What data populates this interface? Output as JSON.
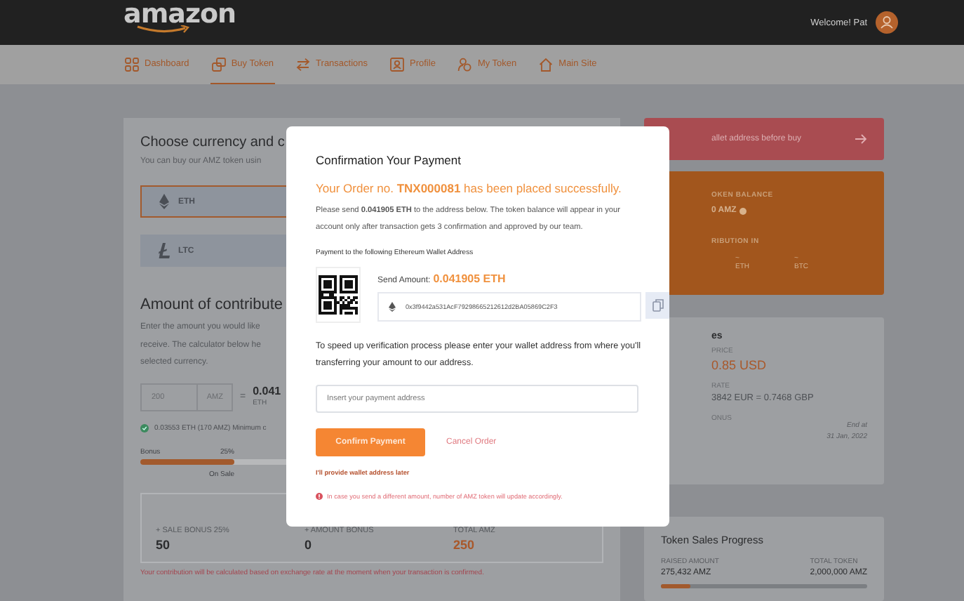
{
  "header": {
    "logo": "amazon",
    "welcome": "Welcome! Pat"
  },
  "nav": [
    {
      "label": "Dashboard",
      "selected": false
    },
    {
      "label": "Buy Token",
      "selected": true
    },
    {
      "label": "Transactions",
      "selected": false
    },
    {
      "label": "Profile",
      "selected": false
    },
    {
      "label": "My Token",
      "selected": false
    },
    {
      "label": "Main Site",
      "selected": false
    }
  ],
  "currency": {
    "title": "Choose currency and c",
    "subtitle": "You can buy our AMZ token usin",
    "options": [
      {
        "label": "ETH",
        "selected": true
      },
      {
        "label": "LTC",
        "selected": false
      }
    ]
  },
  "contribute": {
    "title": "Amount of contribute",
    "lines": [
      "Enter the amount you would like",
      "receive. The calculator below he",
      "selected currency."
    ],
    "amount": "200",
    "unit": "AMZ",
    "equals": "=",
    "result": "0.041",
    "result_unit": "ETH",
    "minimum": "0.03553 ETH (170 AMZ) Minimum c",
    "bonus_label": "Bonus",
    "bonus_value": "25%",
    "bonus_bar": {
      "level": 0.35
    },
    "bonus_caption": "On Sale",
    "totals": [
      {
        "label": "+ SALE BONUS 25%",
        "value": "50"
      },
      {
        "label": "+ AMOUNT BONUS",
        "value": "0"
      },
      {
        "label": "TOTAL AMZ",
        "value": "250"
      }
    ],
    "note": "Your contribution will be calculated based on exchange rate at the moment when your transaction is confirmed."
  },
  "banner": {
    "text": "allet address before buy"
  },
  "balance": {
    "label": "OKEN BALANCE",
    "value": "0 AMZ",
    "dist_label": "RIBUTION IN",
    "items": [
      {
        "value": "~",
        "unit": "ETH"
      },
      {
        "value": "~",
        "unit": "BTC"
      }
    ]
  },
  "sales": {
    "title": "es",
    "price_label": "PRICE",
    "price": "0.85 USD",
    "rate_label": "RATE",
    "rate": "3842 EUR = 0.7468 GBP",
    "bonus_label": "ONUS",
    "end_label": "End at",
    "end_date": "31 Jan, 2022"
  },
  "progress": {
    "title": "Token Sales Progress",
    "raised_label": "RAISED AMOUNT",
    "raised": "275,432 AMZ",
    "total_label": "TOTAL TOKEN",
    "total": "2,000,000 AMZ",
    "level": 0.14
  },
  "modal": {
    "title": "Confirmation Your Payment",
    "order": "Your Order no. **TNX000081** has been placed successfully.",
    "message": "Please send **0.041905 ETH** to the address below. The token balance will appear in your account only after transaction gets 3 confirmation and approved by our team.",
    "wallet_label": "Payment to the following Ethereum Wallet Address",
    "send_label": "Send Amount:",
    "send_value": "0.041905 ETH",
    "address": "0x3f9442a531AcF79298665212612d2BA05869C2F3",
    "speed_text": "To speed up verification process please enter your wallet address from where you'll transferring your amount to our address.",
    "placeholder": "Insert your payment address",
    "confirm": "Confirm Payment",
    "cancel": "Cancel Order",
    "later": "I'll provide wallet address later",
    "warning": "In case you send a different amount, number of AMZ token will update accordingly."
  }
}
